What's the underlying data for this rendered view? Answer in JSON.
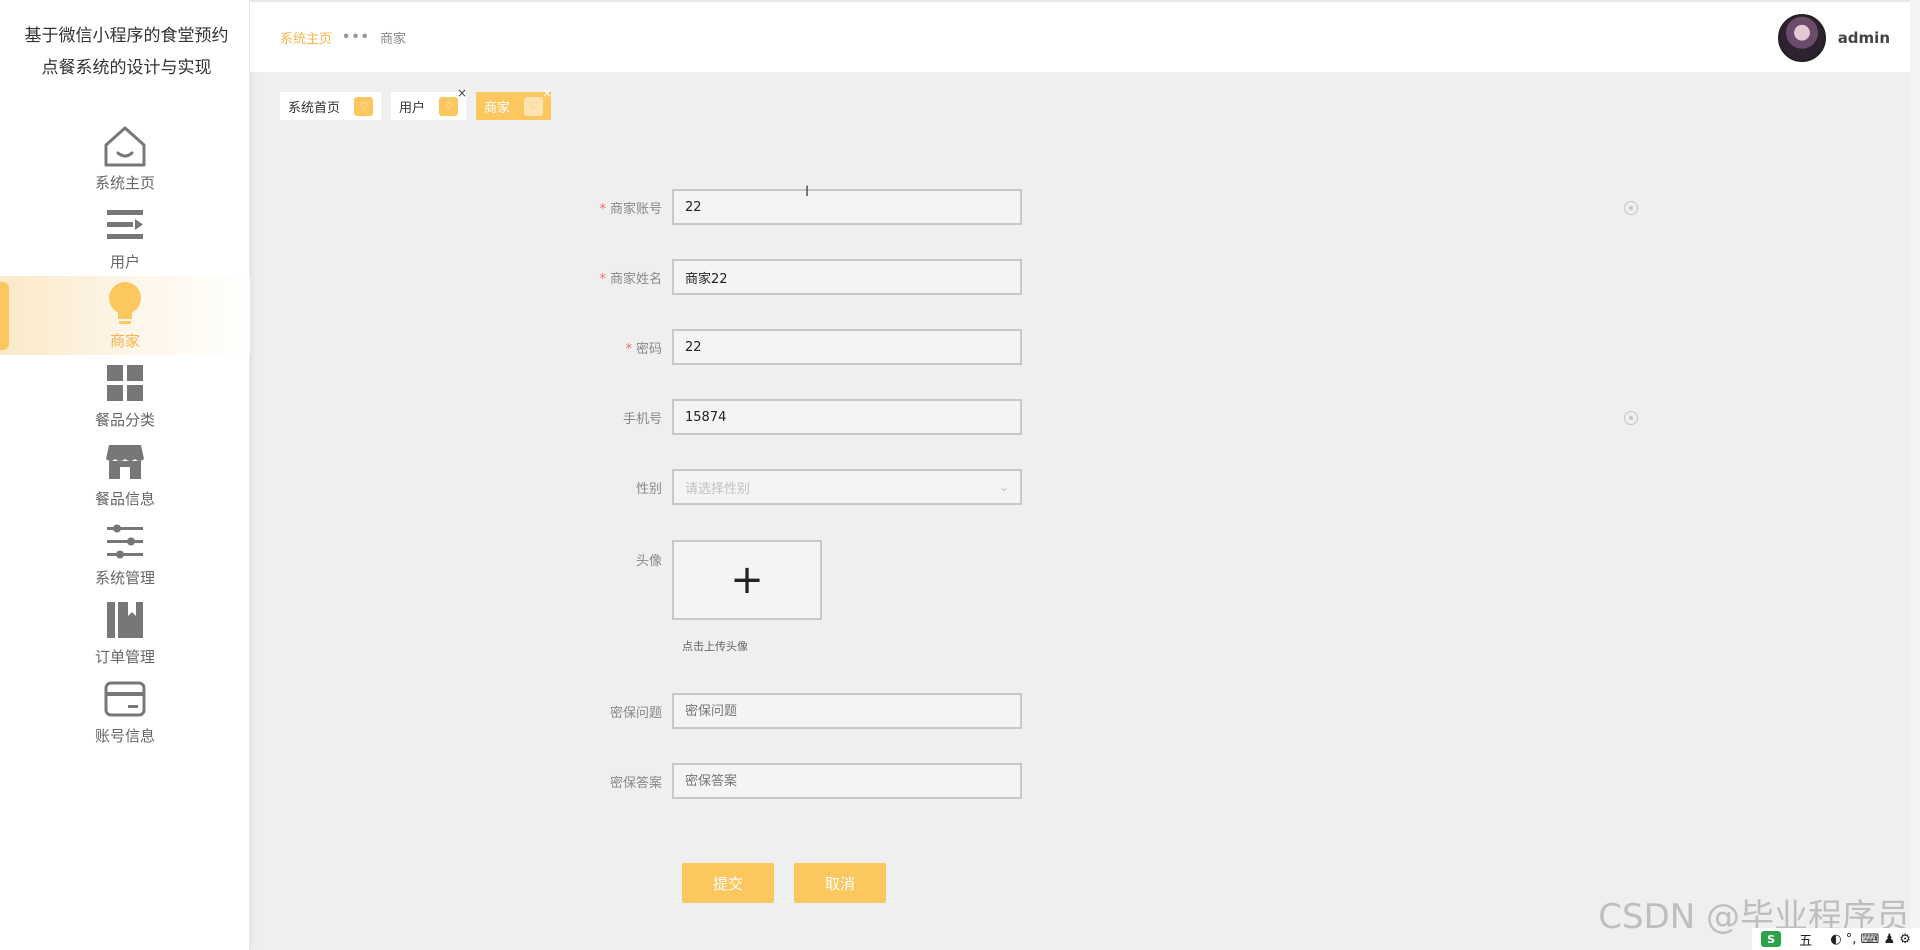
{
  "app": {
    "title": "基于微信小程序的食堂预约点餐系统的设计与实现"
  },
  "sidebar": {
    "items": [
      {
        "label": "系统主页",
        "icon": "home-icon",
        "active": false
      },
      {
        "label": "用户",
        "icon": "list-icon",
        "active": false
      },
      {
        "label": "商家",
        "icon": "bulb-icon",
        "active": true
      },
      {
        "label": "餐品分类",
        "icon": "grid-icon",
        "active": false
      },
      {
        "label": "餐品信息",
        "icon": "shop-icon",
        "active": false
      },
      {
        "label": "系统管理",
        "icon": "sliders-icon",
        "active": false
      },
      {
        "label": "订单管理",
        "icon": "book-icon",
        "active": false
      },
      {
        "label": "账号信息",
        "icon": "card-icon",
        "active": false
      }
    ]
  },
  "header": {
    "breadcrumb": {
      "home": "系统主页",
      "separator": "•••",
      "current": "商家"
    },
    "user": {
      "name": "admin"
    }
  },
  "tags": [
    {
      "label": "系统首页",
      "closable": false,
      "active": false
    },
    {
      "label": "用户",
      "closable": true,
      "active": false
    },
    {
      "label": "商家",
      "closable": true,
      "active": true
    }
  ],
  "form": {
    "account": {
      "label": "商家账号",
      "required": true,
      "value": "22"
    },
    "name": {
      "label": "商家姓名",
      "required": true,
      "value": "商家22"
    },
    "password": {
      "label": "密码",
      "required": true,
      "value": "22"
    },
    "phone": {
      "label": "手机号",
      "required": false,
      "value": "15874"
    },
    "gender": {
      "label": "性别",
      "placeholder": "请选择性别"
    },
    "avatar": {
      "label": "头像",
      "plus": "+",
      "hint": "点击上传头像"
    },
    "question": {
      "label": "密保问题",
      "placeholder": "密保问题"
    },
    "answer": {
      "label": "密保答案",
      "placeholder": "密保答案"
    },
    "submit_label": "提交",
    "cancel_label": "取消"
  },
  "misc": {
    "watermark": "CSDN @毕业程序员",
    "tray": {
      "logo": "S",
      "text": "五",
      "symbols": "◐ °, ⌨ ♟ ⚙"
    }
  },
  "colors": {
    "accent": "#fbc75e",
    "accent_text": "#f7b54a",
    "required": "#f56c6c"
  }
}
